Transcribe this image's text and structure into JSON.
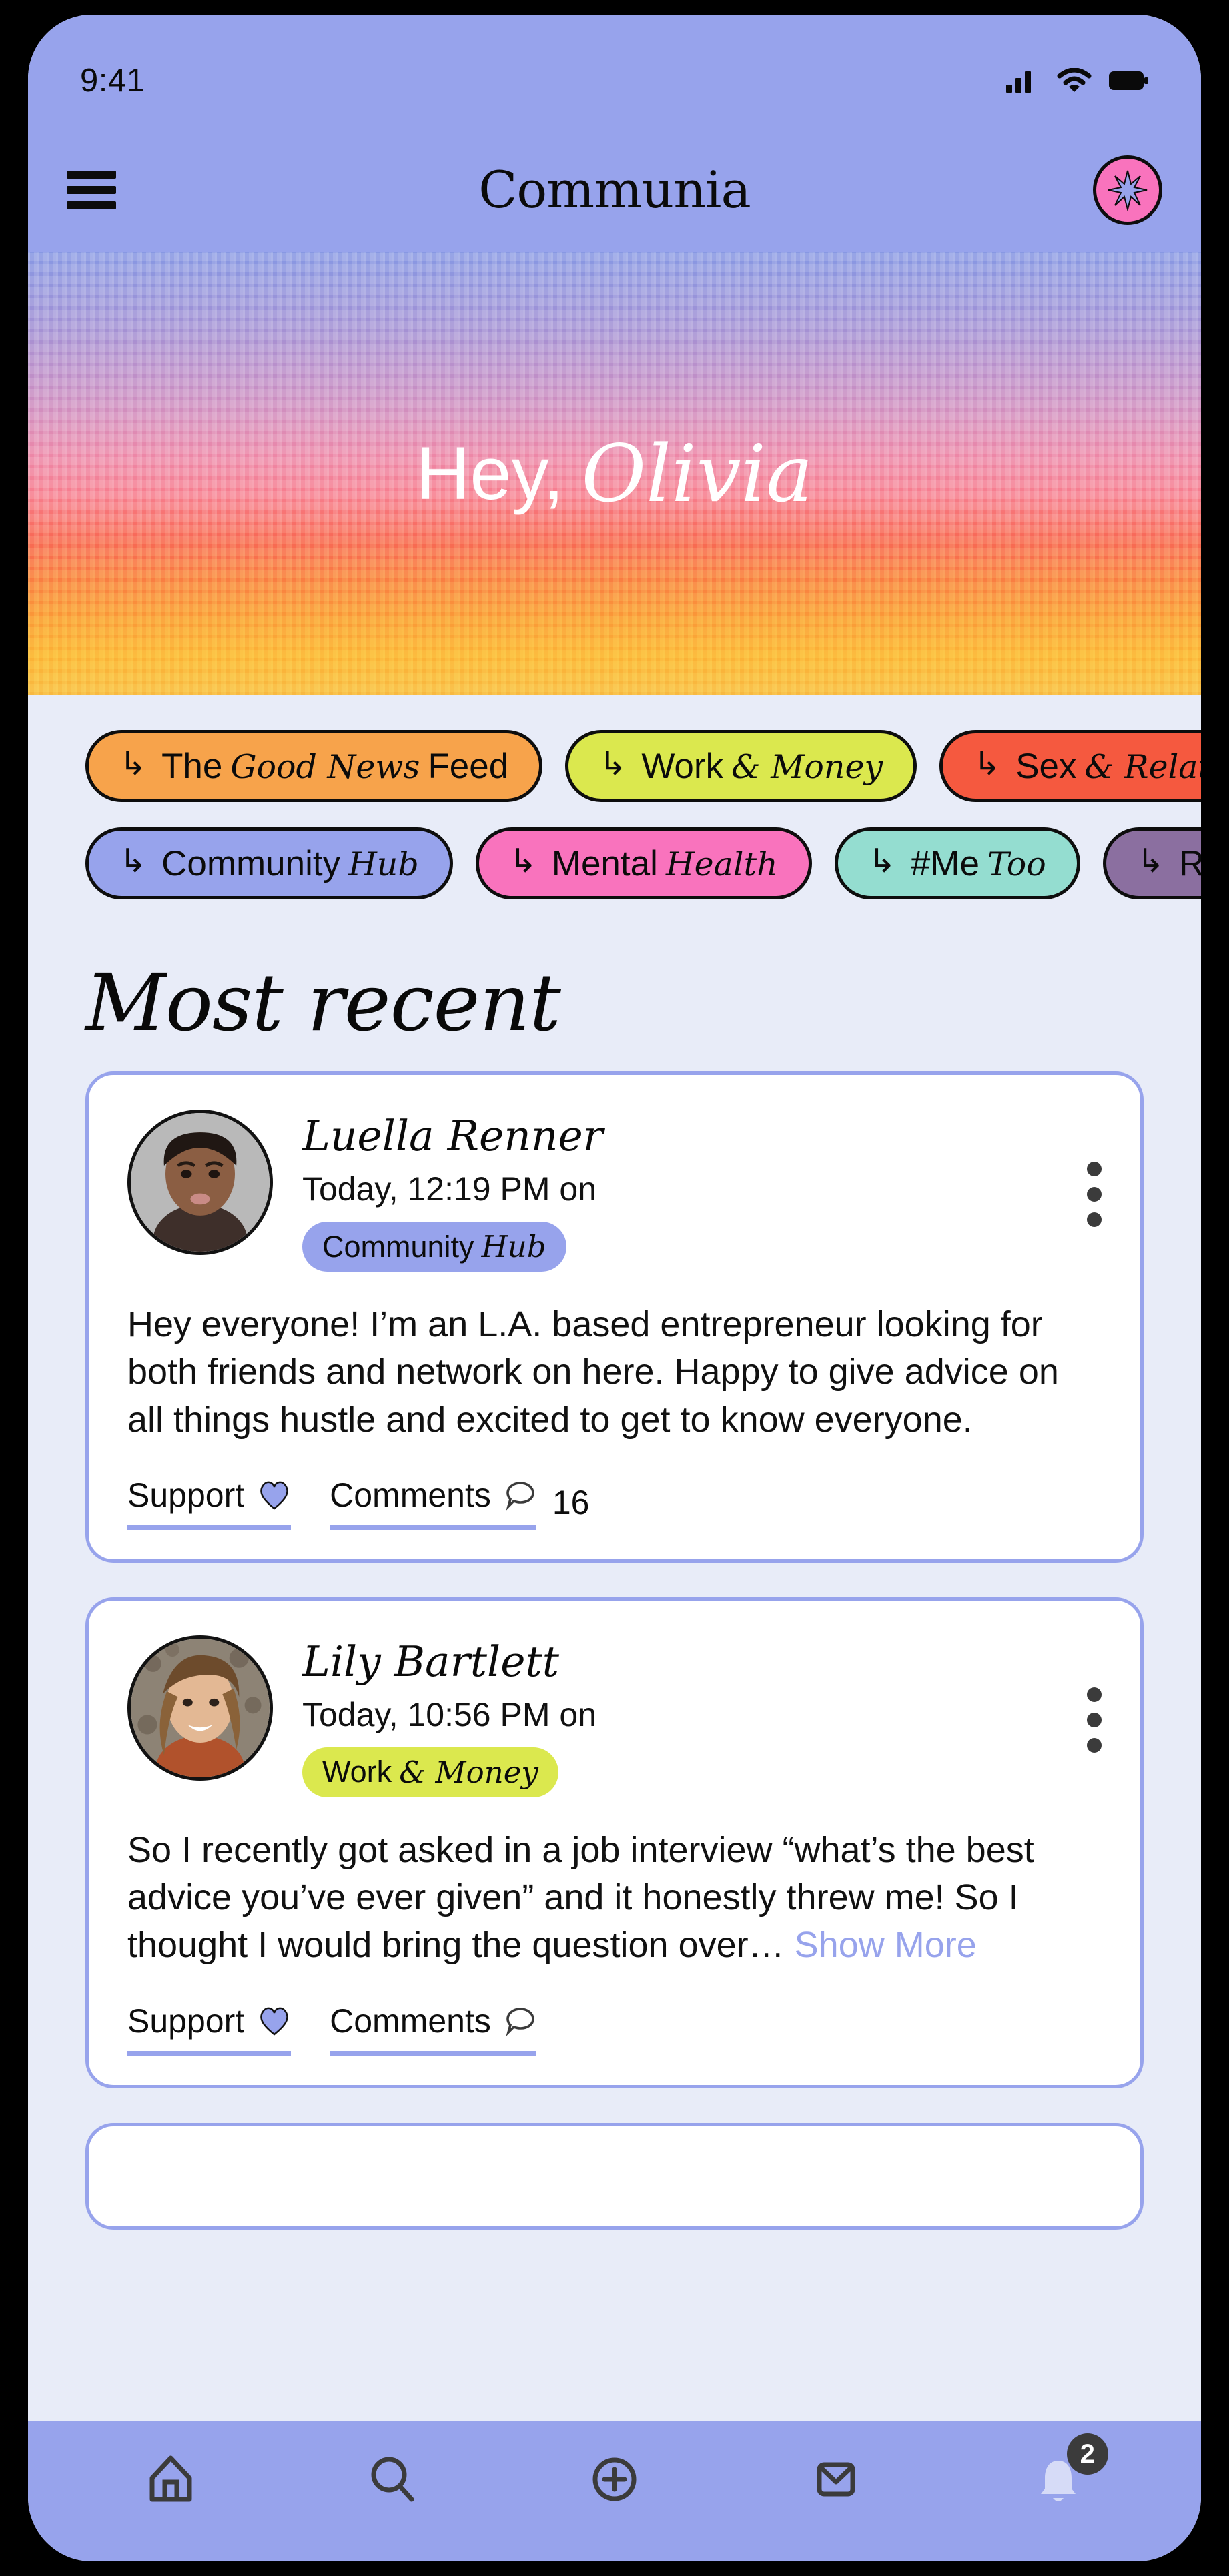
{
  "status_bar": {
    "time": "9:41",
    "icons": [
      "signal-icon",
      "wifi-icon",
      "battery-icon"
    ]
  },
  "header": {
    "menu_icon": "hamburger-menu-icon",
    "brand": "Communia",
    "avatar_icon": "sparkle-star-icon",
    "avatar_bg": "#f973bd",
    "bar_bg": "#97a3ec"
  },
  "hero": {
    "greeting": "Hey,",
    "user_name": "Olivia",
    "gradient_stops": [
      "#93a2e6",
      "#c59ace",
      "#ef93b0",
      "#f9755f",
      "#fba43e",
      "#f9c04a"
    ]
  },
  "categories": {
    "arrow_icon": "corner-down-right-arrow-icon",
    "rows": [
      [
        {
          "prefix": "The",
          "italic": "Good News",
          "suffix": "Feed",
          "color": "#f7a34b"
        },
        {
          "prefix": "Work",
          "italic": "& Money",
          "suffix": "",
          "color": "#dbe84e"
        },
        {
          "prefix": "Sex",
          "italic": "& Relat",
          "suffix": "",
          "color": "#f5593f"
        }
      ],
      [
        {
          "prefix": "Community",
          "italic": "Hub",
          "suffix": "",
          "color": "#97a3ec"
        },
        {
          "prefix": "Mental",
          "italic": "Health",
          "suffix": "",
          "color": "#f973bd"
        },
        {
          "prefix": "#Me",
          "italic": "Too",
          "suffix": "",
          "color": "#94ddd0"
        },
        {
          "prefix": "R",
          "italic": "",
          "suffix": "",
          "color": "#8b6fa0"
        }
      ]
    ]
  },
  "feed": {
    "section_title": "Most recent",
    "posts": [
      {
        "author": "Luella Renner",
        "timestamp": "Today, 12:19 PM on",
        "tag_prefix": "Community",
        "tag_italic": "Hub",
        "tag_color": "#97a3ec",
        "body": "Hey everyone! I’m an L.A. based entrepreneur looking for both friends and network on here. Happy to give advice on all things hustle and excited to get to know everyone.",
        "show_more": "",
        "support_label": "Support",
        "support_icon": "heart-icon",
        "comments_label": "Comments",
        "comments_icon": "speech-bubble-icon",
        "comments_count": "16",
        "menu_icon": "more-vertical-icon",
        "avatar_icon": "user-avatar-photo"
      },
      {
        "author": "Lily Bartlett",
        "timestamp": "Today, 10:56 PM on",
        "tag_prefix": "Work",
        "tag_italic": "& Money",
        "tag_color": "#dbe84e",
        "body": "So I recently got asked in a job interview “what’s the best advice you’ve ever given” and it honestly threw me! So I thought I would bring the question over… ",
        "show_more": "Show More",
        "support_label": "Support",
        "support_icon": "heart-icon",
        "comments_label": "Comments",
        "comments_icon": "speech-bubble-icon",
        "comments_count": "",
        "menu_icon": "more-vertical-icon",
        "avatar_icon": "user-avatar-photo"
      }
    ]
  },
  "bottom_nav": {
    "bg": "#97a3ec",
    "items": [
      {
        "name": "home-icon",
        "active": false
      },
      {
        "name": "search-icon",
        "active": false
      },
      {
        "name": "add-plus-icon",
        "active": false
      },
      {
        "name": "mail-envelope-icon",
        "active": false
      },
      {
        "name": "bell-notification-icon",
        "active": true,
        "badge": "2"
      }
    ]
  },
  "accent_colors": {
    "periwinkle": "#97a3ec",
    "page_bg": "#e8ecf8",
    "card_bg": "#ffffff"
  }
}
